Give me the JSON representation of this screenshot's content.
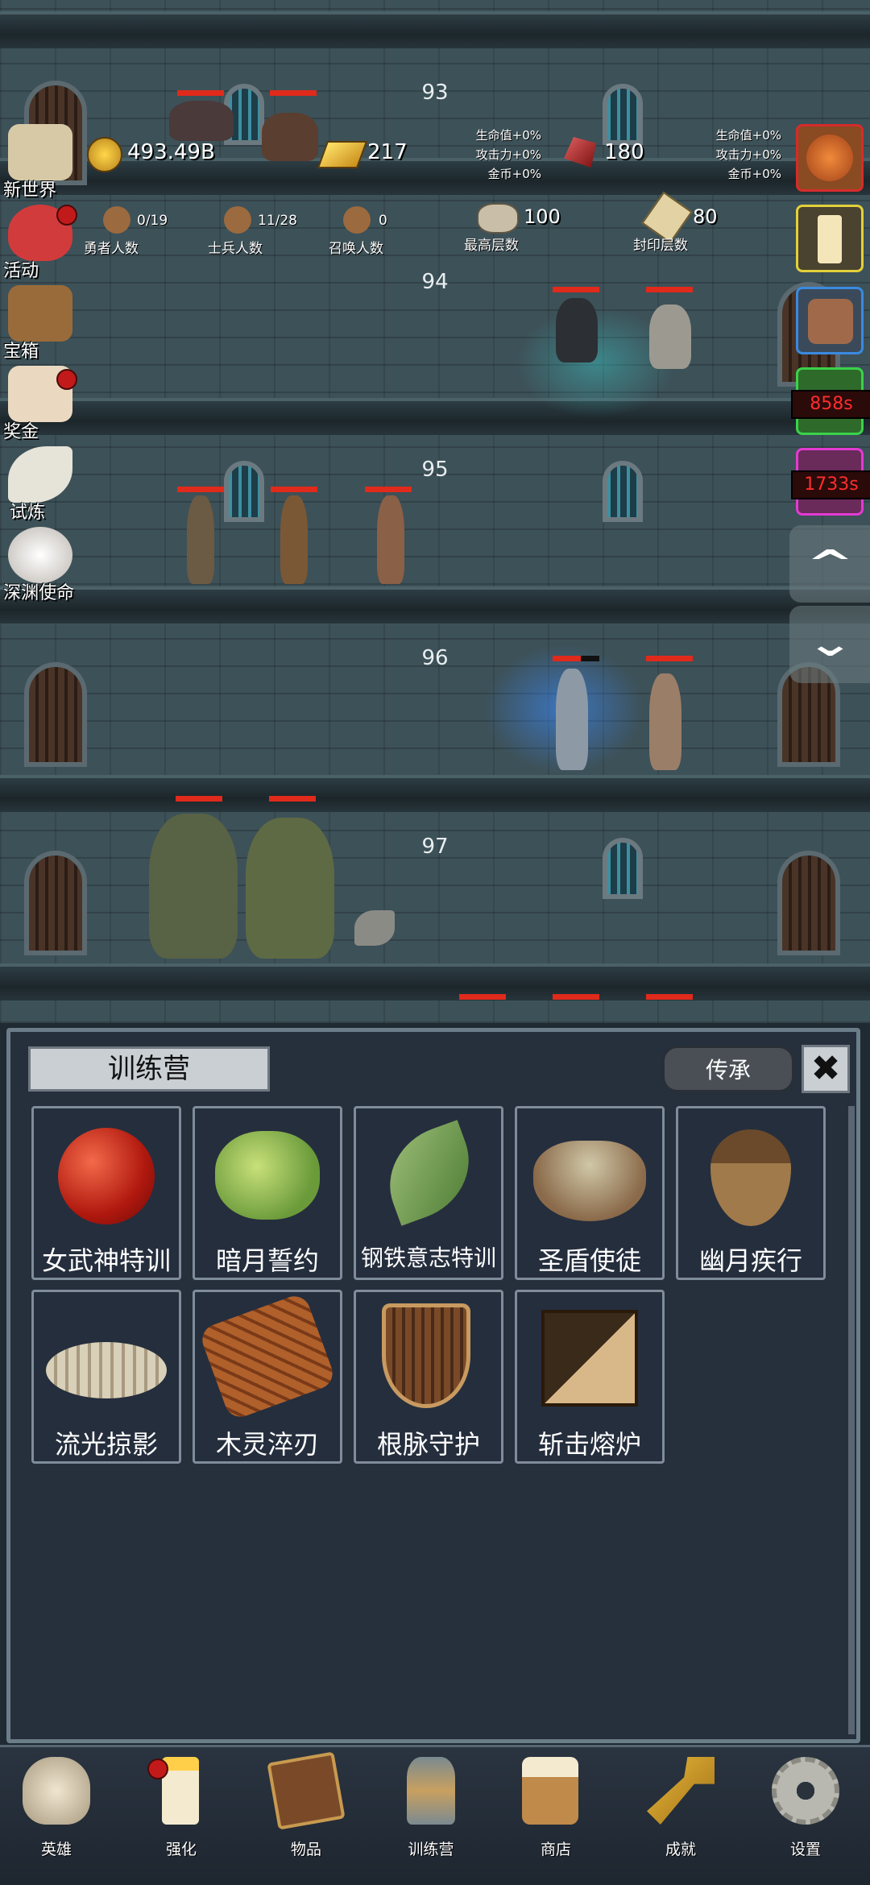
{
  "floors": [
    "93",
    "94",
    "95",
    "96",
    "97"
  ],
  "header": {
    "gold": "493.49B",
    "gold_bar": "217",
    "ruby": "180",
    "bonus_left": [
      "生命值+0%",
      "攻击力+0%",
      "金币+0%"
    ],
    "bonus_right": [
      "生命值+0%",
      "攻击力+0%",
      "金币+0%"
    ],
    "heroes_count": "0/19",
    "heroes_label": "勇者人数",
    "soldiers_count": "11/28",
    "soldiers_label": "士兵人数",
    "summon_count": "0",
    "summon_label": "召唤人数",
    "max_floor": "100",
    "max_floor_label": "最高层数",
    "seal_floor": "80",
    "seal_floor_label": "封印层数"
  },
  "left_menu": [
    "新世界",
    "活动",
    "宝箱",
    "奖金",
    "试炼",
    "深渊使命"
  ],
  "right_menu": {
    "timer1": "858s",
    "timer2": "1733s",
    "up": "^",
    "down": "⌄"
  },
  "panel": {
    "title": "训练营",
    "inherit": "传承",
    "close": "✖",
    "cards": [
      {
        "name": "女武神特训",
        "icon": "red-apple-icon"
      },
      {
        "name": "暗月誓约",
        "icon": "cabbage-icon"
      },
      {
        "name": "钢铁意志特训",
        "icon": "leaf-icon"
      },
      {
        "name": "圣盾使徒",
        "icon": "porridge-bowl-icon"
      },
      {
        "name": "幽月疾行",
        "icon": "acorn-icon"
      },
      {
        "name": "流光掠影",
        "icon": "fish-fossil-icon"
      },
      {
        "name": "木灵淬刃",
        "icon": "wood-log-icon"
      },
      {
        "name": "根脉守护",
        "icon": "wooden-shield-icon"
      },
      {
        "name": "斩击熔炉",
        "icon": "brick-block-icon"
      }
    ]
  },
  "bottom_nav": [
    "英雄",
    "强化",
    "物品",
    "训练营",
    "商店",
    "成就",
    "设置"
  ],
  "colors": {
    "hp": "#e02a1b",
    "panel_bg": "#262f3c",
    "timer_text": "#ff2d2d"
  }
}
